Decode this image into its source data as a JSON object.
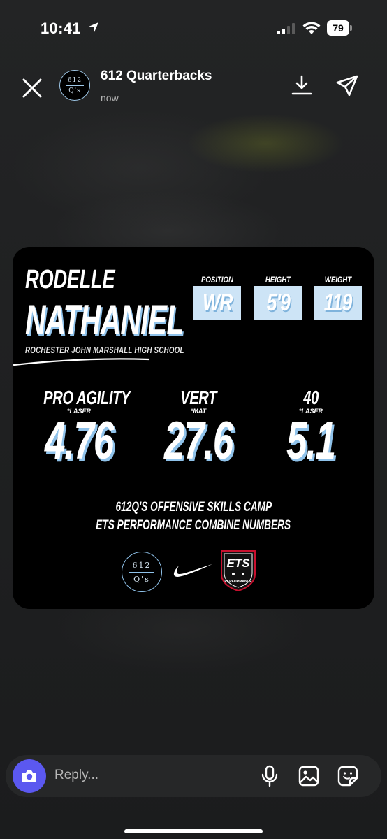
{
  "status_bar": {
    "time": "10:41",
    "battery": "79"
  },
  "header": {
    "account": "612 Quarterbacks",
    "time": "now",
    "avatar_top": "612",
    "avatar_bottom": "Q's"
  },
  "card": {
    "first_name": "RODELLE",
    "last_name": "NATHANIEL",
    "school": "ROCHESTER JOHN MARSHALL HIGH SCHOOL",
    "stats": [
      {
        "label": "POSITION",
        "value": "WR"
      },
      {
        "label": "HEIGHT",
        "value": "5'9"
      },
      {
        "label": "WEIGHT",
        "value": "119"
      }
    ],
    "metrics": [
      {
        "label": "PRO AGILITY",
        "note": "*LASER",
        "value": "4.76"
      },
      {
        "label": "VERT",
        "note": "*MAT",
        "value": "27.6"
      },
      {
        "label": "40",
        "note": "*LASER",
        "value": "5.1"
      }
    ],
    "footer_line1": "612Q'S OFFENSIVE SKILLS CAMP",
    "footer_line2": "ETS PERFORMANCE COMBINE NUMBERS",
    "logo_612_top": "612",
    "logo_612_bottom": "Q's",
    "ets_text": "ETS",
    "ets_sub": "PERFORMANCE",
    "accent_color": "#8fc2ea"
  },
  "reply": {
    "placeholder": "Reply..."
  }
}
